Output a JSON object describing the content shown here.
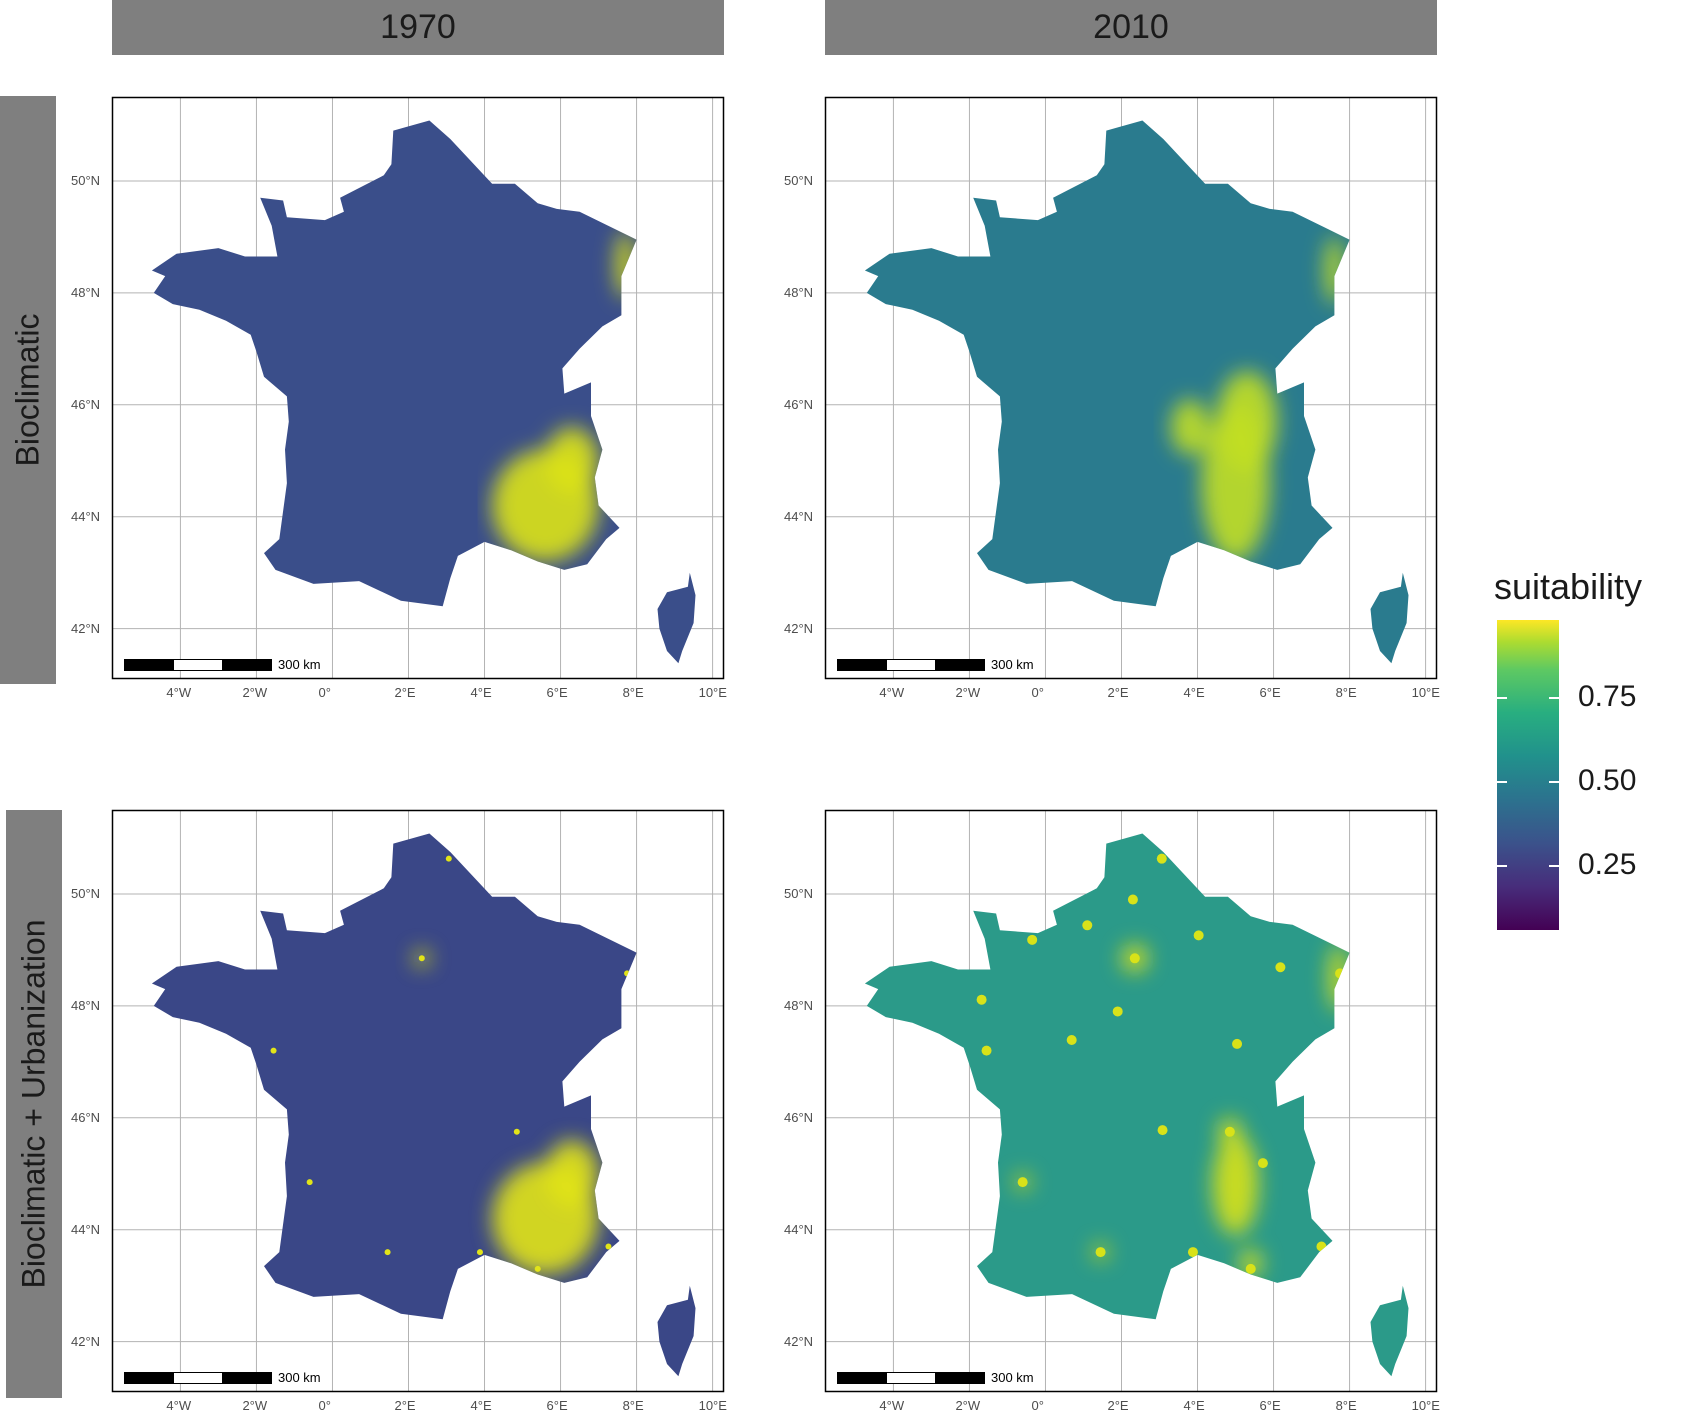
{
  "columns": [
    "1970",
    "2010"
  ],
  "rows": [
    "Bioclimatic",
    "Bioclimatic + Urbanization"
  ],
  "axes": {
    "x_ticks": [
      "4°W",
      "2°W",
      "0°",
      "2°E",
      "4°E",
      "6°E",
      "8°E",
      "10°E"
    ],
    "y_ticks": [
      "50°N",
      "48°N",
      "46°N",
      "44°N",
      "42°N"
    ]
  },
  "scalebar_label": "300 km",
  "legend": {
    "title": "suitability",
    "labels": [
      "0.75",
      "0.50",
      "0.25"
    ],
    "values": [
      0.75,
      0.5,
      0.25
    ]
  },
  "colors": {
    "strip": "#7f7f7f",
    "viridis_low": "#440154",
    "viridis_mid": "#21918c",
    "viridis_high": "#fde725"
  },
  "panels": [
    {
      "row": "Bioclimatic",
      "column": "1970",
      "base_color": "#3a4e8a",
      "hotspot_color": "#dce319"
    },
    {
      "row": "Bioclimatic",
      "column": "2010",
      "base_color": "#2a7b8e",
      "hotspot_color": "#c2df23"
    },
    {
      "row": "Bioclimatic + Urbanization",
      "column": "1970",
      "base_color": "#3a4787",
      "hotspot_color": "#e2e418"
    },
    {
      "row": "Bioclimatic + Urbanization",
      "column": "2010",
      "base_color": "#2b9a89",
      "hotspot_color": "#d8e219"
    }
  ]
}
